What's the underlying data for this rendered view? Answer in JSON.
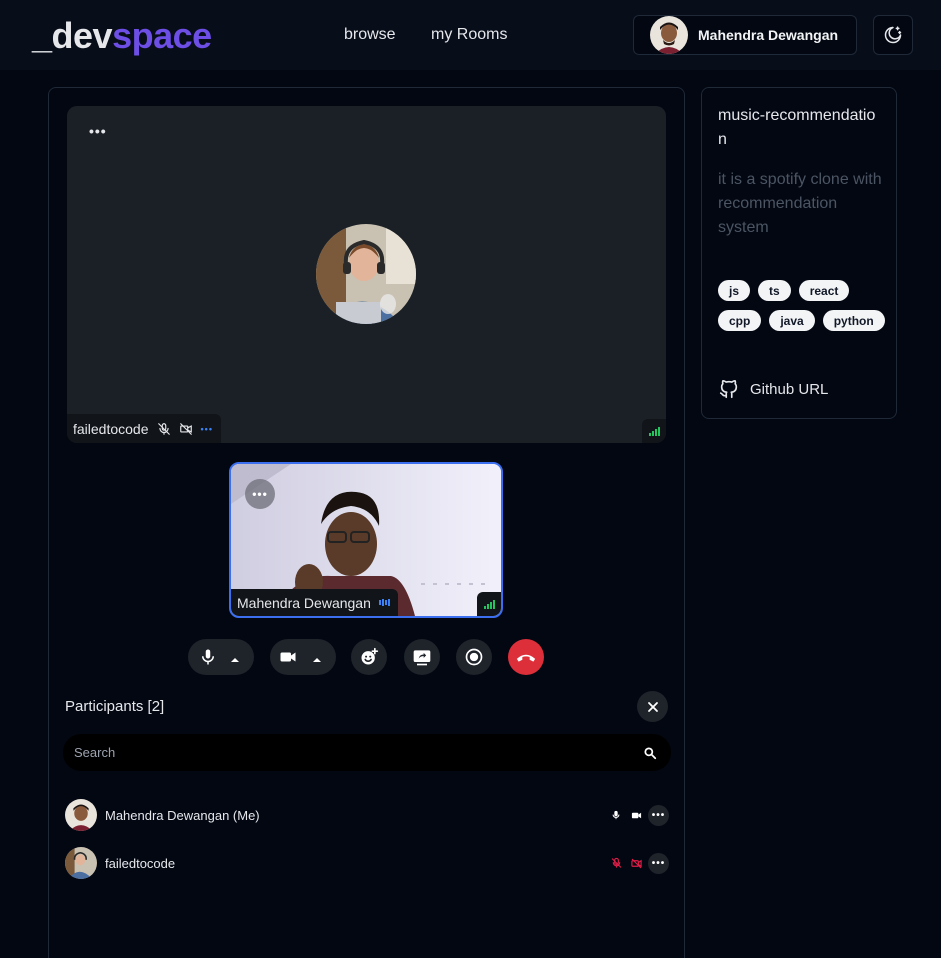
{
  "header": {
    "logo_prefix": "_dev",
    "logo_accent": "space",
    "nav": [
      {
        "label": "browse"
      },
      {
        "label": "my Rooms"
      }
    ],
    "user_name": "Mahendra Dewangan",
    "theme_icon": "moon-stars-icon",
    "accent_color": "#6d4fe6"
  },
  "call": {
    "remote": {
      "name": "failedtocode",
      "menu_icon": "more-dots-icon",
      "mic_icon": "mic-off-icon",
      "cam_icon": "camera-off-icon"
    },
    "self": {
      "name": "Mahendra Dewangan",
      "speaking_icon": "audio-level-icon",
      "border_color": "#3b6ff0"
    },
    "controls": [
      {
        "name": "mic",
        "icon": "mic-icon"
      },
      {
        "name": "camera",
        "icon": "video-camera-icon"
      },
      {
        "name": "reactions",
        "icon": "emoji-add-icon"
      },
      {
        "name": "screen-share",
        "icon": "screen-share-icon"
      },
      {
        "name": "record",
        "icon": "record-icon"
      },
      {
        "name": "leave",
        "icon": "phone-hangup-icon",
        "color": "#dc2f3a"
      }
    ]
  },
  "participants": {
    "title": "Participants [2]",
    "search_placeholder": "Search",
    "list": [
      {
        "name": "Mahendra Dewangan (Me)",
        "mic": "on",
        "cam": "on"
      },
      {
        "name": "failedtocode",
        "mic": "off",
        "cam": "off",
        "off_color": "#e11d48"
      }
    ]
  },
  "room": {
    "title": "music-recommendation",
    "description": "it is a spotify clone with recommendation system",
    "tags": [
      "js",
      "ts",
      "react",
      "cpp",
      "java",
      "python"
    ],
    "github_label": "Github URL",
    "github_icon": "github-icon"
  }
}
